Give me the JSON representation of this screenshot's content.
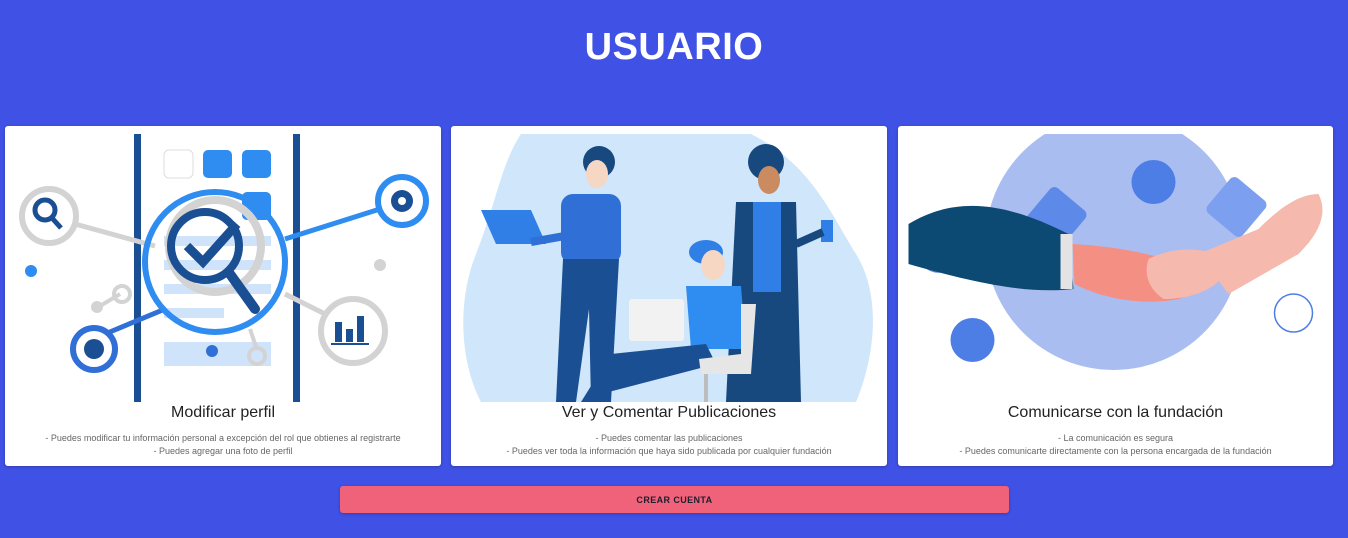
{
  "header": {
    "title": "USUARIO"
  },
  "cards": [
    {
      "title": "Modificar perfil",
      "lines": [
        "- Puedes modificar tu información personal a excepción del rol que obtienes al registrarte",
        "- Puedes agregar una foto de perfil"
      ]
    },
    {
      "title": "Ver y Comentar Publicaciones",
      "lines": [
        "- Puedes comentar las publicaciones",
        "- Puedes ver toda la información que haya sido publicada por cualquier fundación"
      ]
    },
    {
      "title": "Comunicarse con la fundación",
      "lines": [
        "- La comunicación es segura",
        "- Puedes comunicarte directamente con la persona encargada de la fundación"
      ]
    }
  ],
  "actions": {
    "create_account_label": "CREAR CUENTA"
  },
  "colors": {
    "background": "#4052e6",
    "button": "#f0627a",
    "card": "#ffffff"
  }
}
